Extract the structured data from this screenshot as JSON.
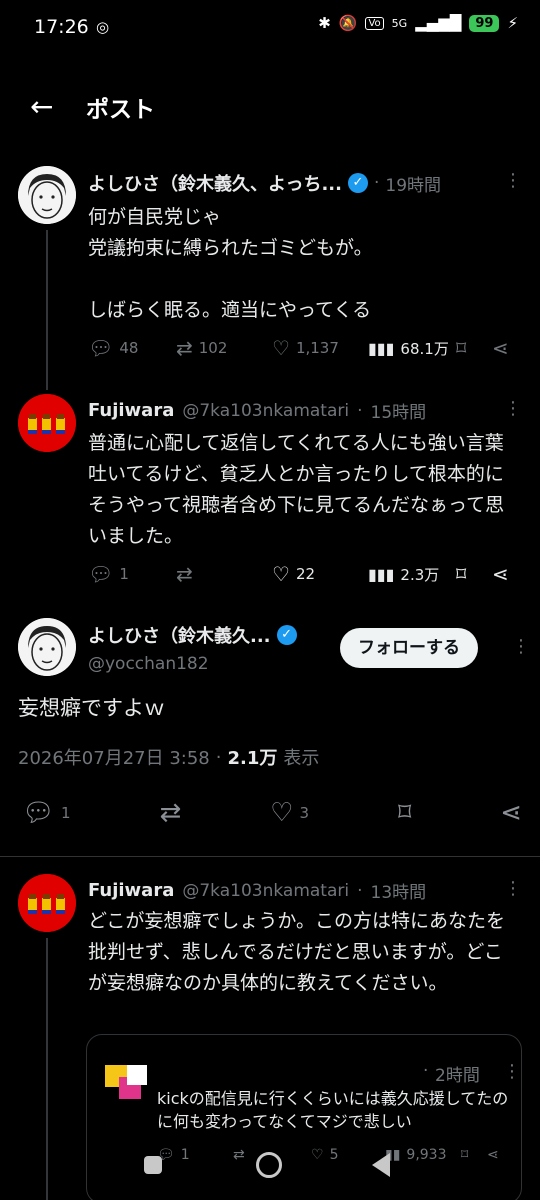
{
  "status_bar": {
    "time": "17:26",
    "battery": "99",
    "net": "5G"
  },
  "header": {
    "title": "ポスト"
  },
  "post1": {
    "name": "よしひさ（鈴木義久、よっち...",
    "time": "19時間",
    "body": "何が自民党じゃ\n党議拘束に縛られたゴミどもが。\n\nしばらく眠る。適当にやってくる",
    "replies": "48",
    "reposts": "102",
    "likes": "1,137",
    "views": "68.1万"
  },
  "post2": {
    "name": "Fujiwara",
    "handle": "@7ka103nkamatari",
    "time": "15時間",
    "body": "普通に心配して返信してくれてる人にも強い言葉吐いてるけど、貧乏人とか言ったりして根本的にそうやって視聴者含め下に見てるんだなぁって思いました。",
    "replies": "1",
    "likes": "22",
    "views": "2.3万"
  },
  "main_post": {
    "name": "よしひさ（鈴木義久...",
    "handle": "@yocchan182",
    "follow_label": "フォローする",
    "body": "妄想癖ですよｗ",
    "date": "2026年07月27日 3:58",
    "views_count": "2.1万",
    "views_label": "表示",
    "replies": "1",
    "likes": "3"
  },
  "post3": {
    "name": "Fujiwara",
    "handle": "@7ka103nkamatari",
    "time": "13時間",
    "body": "どこが妄想癖でしょうか。この方は特にあなたを批判せず、悲しんでるだけだと思いますが。どこが妄想癖なのか具体的に教えてください。"
  },
  "quoted": {
    "time": "2時間",
    "body": "kickの配信見に行くくらいには義久応援してたのに何も変わってなくてマジで悲しい",
    "replies": "1",
    "likes": "5",
    "views": "9,933"
  },
  "colors": {
    "accent": "#1d9bf0",
    "background": "#000000",
    "muted": "#71767b"
  }
}
